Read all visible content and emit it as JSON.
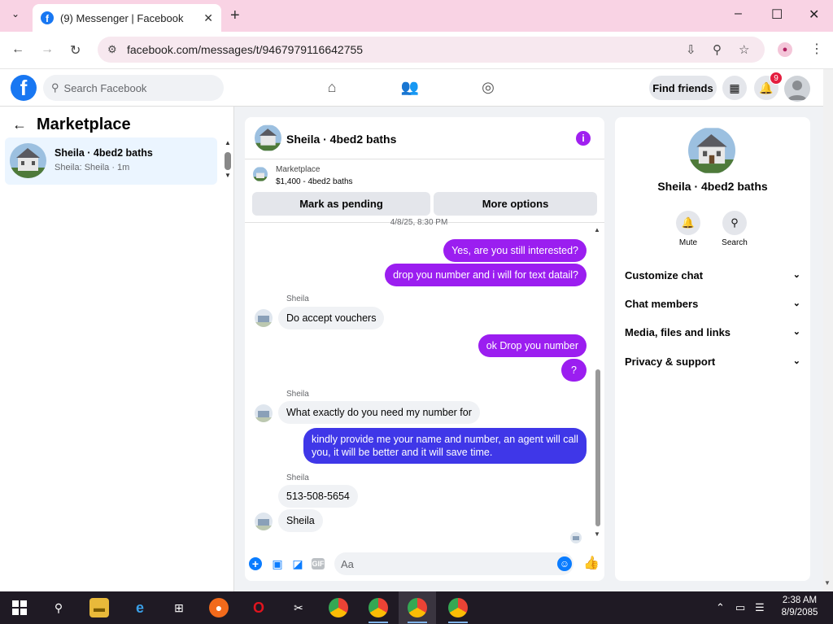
{
  "browser": {
    "tab_title": "(9) Messenger | Facebook",
    "tab_dropdown": "⌄",
    "tab_close": "✕",
    "new_tab": "+",
    "url": "facebook.com/messages/t/9467979116642755",
    "window_controls": [
      "–",
      "☐",
      "✕"
    ]
  },
  "fb_header": {
    "search_placeholder": "Search Facebook",
    "find_friends": "Find friends",
    "notification_count": "9"
  },
  "left_panel": {
    "title": "Marketplace",
    "conversation": {
      "title": "Sheila · 4bed2 baths",
      "subtitle": "Sheila: Sheila · 1m"
    }
  },
  "chat": {
    "title": "Sheila · 4bed2 baths",
    "listing_label": "Marketplace",
    "listing_detail": "$1,400 - 4bed2 baths",
    "mark_pending": "Mark as pending",
    "more_options": "More options",
    "date_stamp": "4/8/25, 8:30 PM",
    "messages": [
      {
        "from": "me",
        "text": "Yes, are you still interested?"
      },
      {
        "from": "me",
        "text": "drop you number and i will for text datail?"
      },
      {
        "from": "them",
        "sender": "Sheila",
        "text": "Do accept vouchers"
      },
      {
        "from": "me",
        "text": "ok Drop you number"
      },
      {
        "from": "me",
        "text": "?"
      },
      {
        "from": "them",
        "sender": "Sheila",
        "text": "What exactly do you need my number for"
      },
      {
        "from": "me",
        "text": "kindly provide me your name and number, an agent will call you, it will be better and it will save time."
      },
      {
        "from": "them",
        "sender": "Sheila",
        "text": "513-508-5654"
      },
      {
        "from": "them",
        "text": "Sheila"
      }
    ],
    "composer_placeholder": "Aa"
  },
  "right_panel": {
    "title": "Sheila · 4bed2 baths",
    "mute_label": "Mute",
    "search_label": "Search",
    "sections": [
      "Customize chat",
      "Chat members",
      "Media, files and links",
      "Privacy & support"
    ]
  },
  "taskbar": {
    "time": "2:38 AM",
    "date": "8/9/2085"
  },
  "colors": {
    "accent": "#1877f2",
    "outgoing_bubble": "#9b1ef0",
    "incoming_bubble": "#f0f2f5",
    "tabbar": "#f9d3e4"
  }
}
